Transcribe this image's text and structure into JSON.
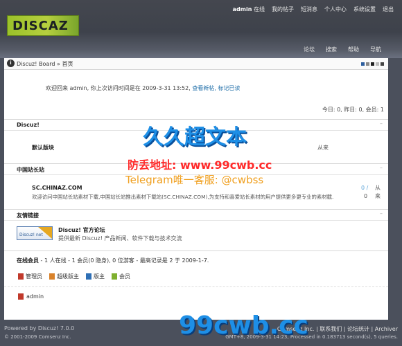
{
  "logo": {
    "text": "DISCAZ"
  },
  "topnav": {
    "username": "admin",
    "status": "在线",
    "items": [
      "我的帖子",
      "短消息",
      "个人中心",
      "系统设置",
      "退出"
    ]
  },
  "mainnav": {
    "items": [
      "论坛",
      "搜索",
      "帮助",
      "导航"
    ]
  },
  "breadcrumb": {
    "home_icon": "i",
    "text": "Discuz! Board » 首页"
  },
  "welcome": {
    "text": "欢迎回来  admin, 你上次访问时间是在  2009-3-31 13:52,",
    "link": "查看新帖, 标记已读"
  },
  "stats": "今日: 0, 昨日: 0, 会员: 1",
  "sections": {
    "discuz": {
      "title": "Discuz!",
      "forum_name": "默认版块",
      "last": "从来"
    },
    "china": {
      "title": "中国站长站",
      "forum_name": "SC.CHINAZ.COM",
      "forum_desc": "欢迎访问中国站长站素材下载,中国站长站推出素材下载站(SC.CHINAZ.COM),为支持和喜爱站长素材的用户提供更多更专业的素材截.",
      "threads": "0 /",
      "posts": "0",
      "last1": "从",
      "last2": "来"
    },
    "links": {
      "title": "友情链接",
      "banner_text": "Discuz! net",
      "site_name": "Discuz! 官方论坛",
      "site_desc": "提供最新 Discuz! 产品新闻、软件下载与技术交流"
    }
  },
  "online": {
    "label": "在线会员",
    "text": "- 1 人在线 - 1 会员(0 隐身), 0 位游客 - 最高记录是 2 于 2009-1-7."
  },
  "legend": {
    "items": [
      {
        "label": "管理员",
        "color": "#c0392b"
      },
      {
        "label": "超级版主",
        "color": "#d9822b"
      },
      {
        "label": "版主",
        "color": "#2e6fb5"
      },
      {
        "label": "会员",
        "color": "#7fb02f"
      }
    ]
  },
  "online_user": "admin",
  "footer": {
    "powered": "Powered by Discuz! 7.0.0",
    "copyright": "© 2001-2009 Comsenz Inc.",
    "links": "Comsenz Inc.  |  联系我们  |  论坛统计  |  Archiver",
    "processed": "GMT+8, 2009-3-31 14:23, Processed in 0.183713 second(s), 5 queries."
  },
  "watermark": {
    "title": "久久超文本",
    "url_line": "防丢地址: www.99cwb.cc",
    "tg_line": "Telegram唯一客服: @cwbss",
    "bottom": "99cwb.cc"
  },
  "colors": {
    "accent": "#1f6ea8",
    "header": "#44474f",
    "watermark_blue": "#1e8fe6",
    "watermark_red": "#ff2a2a"
  }
}
